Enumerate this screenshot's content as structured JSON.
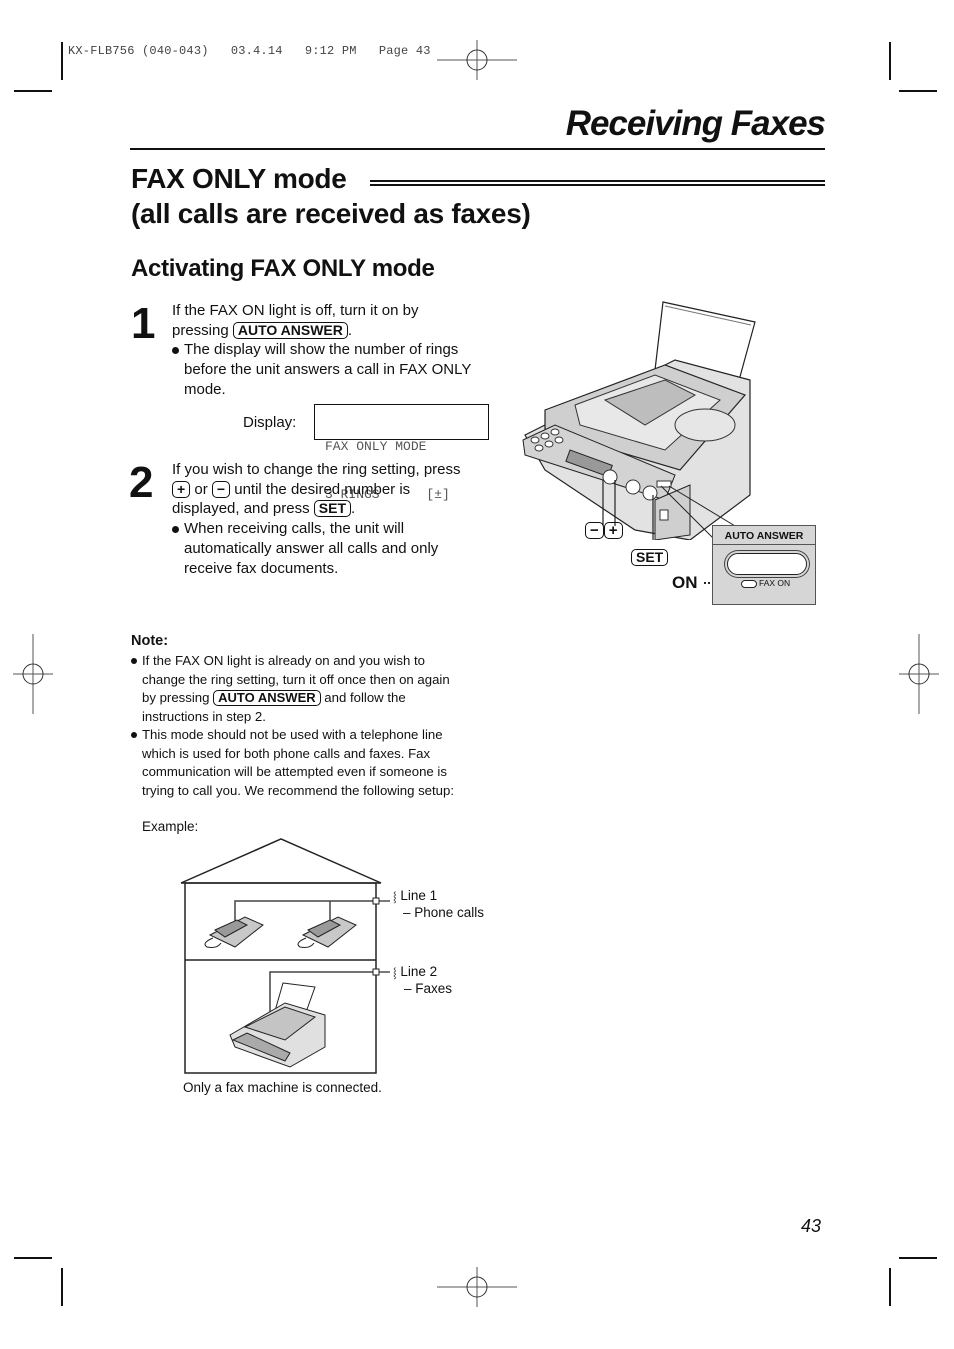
{
  "print_slug": "KX-FLB756 (040-043)   03.4.14   9:12 PM   Page 43",
  "chapter_title": "Receiving Faxes",
  "section": {
    "title_line1": "FAX ONLY mode",
    "title_line2": "(all calls are received as faxes)"
  },
  "subsection_title": "Activating FAX ONLY mode",
  "steps": [
    {
      "number": "1",
      "text_before_key": "If the FAX ON light is off, turn it on by",
      "text_pressing": "pressing",
      "key": "AUTO ANSWER",
      "text_after_key": ".",
      "bullet": [
        "The display will show the number of rings",
        "before the unit answers a call in FAX ONLY",
        "mode."
      ],
      "display_label": "Display:",
      "display_lines": [
        "FAX ONLY MODE",
        "3 RINGS      [±]"
      ]
    },
    {
      "number": "2",
      "line1": "If you wish to change the ring setting, press",
      "key_plus": "+",
      "or": "or",
      "key_minus": "−",
      "line2_rest": "until the desired number is",
      "line3_before": "displayed, and press",
      "key_set": "SET",
      "line3_after": ".",
      "bullet": [
        "When receiving calls, the unit will",
        "automatically answer all calls and only",
        "receive fax documents."
      ]
    }
  ],
  "figure_fax": {
    "key_minus": "−",
    "key_plus": "+",
    "key_set": "SET",
    "on_label": "ON",
    "panel_title": "AUTO ANSWER",
    "light_label": "FAX ON"
  },
  "note": {
    "heading": "Note:",
    "bullet1_lines": [
      "If the FAX ON light is already on and you wish to",
      "change the ring setting, turn it off once then on again"
    ],
    "bullet1_by_pressing": "by pressing",
    "bullet1_key": "AUTO ANSWER",
    "bullet1_after": "and follow the",
    "bullet1_last": "instructions in step 2.",
    "bullet2_lines": [
      "This mode should not be used with a telephone line",
      "which is used for both phone calls and faxes. Fax",
      "communication will be attempted even if someone is",
      "trying to call you. We recommend the following setup:"
    ]
  },
  "example": {
    "label": "Example:",
    "line1_title": "Line 1",
    "line1_desc": "– Phone calls",
    "line2_title": "Line 2",
    "line2_desc": "– Faxes",
    "caption": "Only a fax machine is connected."
  },
  "page_number": "43"
}
